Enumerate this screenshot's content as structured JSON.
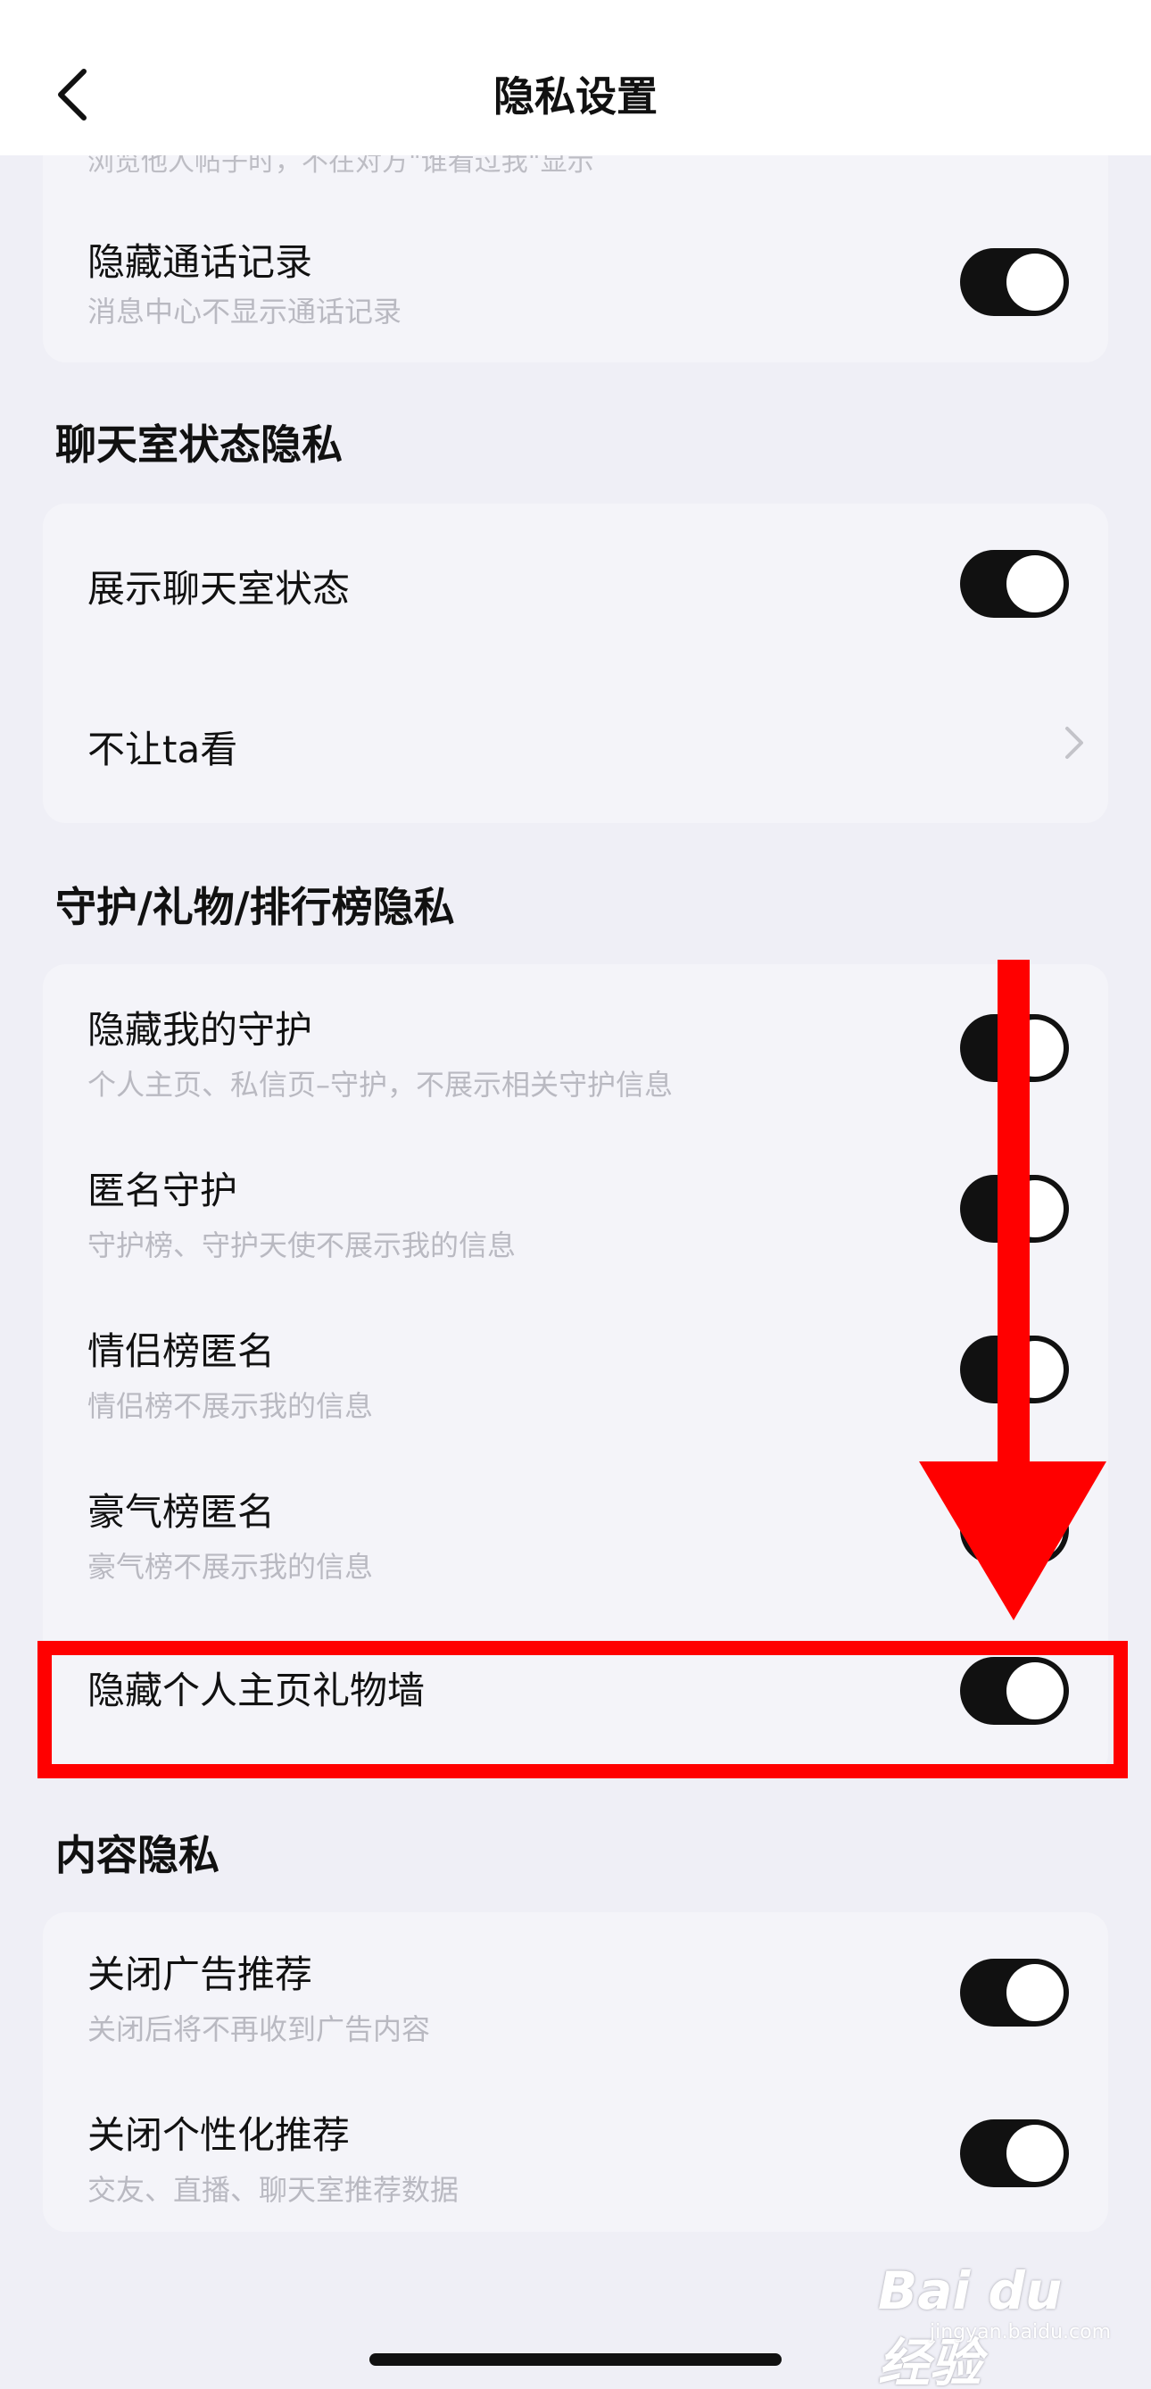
{
  "header": {
    "title": "隐私设置",
    "back_icon": "chevron-left-icon"
  },
  "top_partial": {
    "subtitle": "浏览他人帖子时，不在对方\"谁看过我\"显示"
  },
  "call_card": {
    "title": "隐藏通话记录",
    "subtitle": "消息中心不显示通话记录",
    "enabled": true
  },
  "chatroom": {
    "section_title": "聊天室状态隐私",
    "show_status": {
      "title": "展示聊天室状态",
      "enabled": true
    },
    "hide_from": {
      "title": "不让ta看",
      "icon": "chevron-right-icon"
    }
  },
  "guard": {
    "section_title": "守护/礼物/排行榜隐私",
    "items": [
      {
        "title": "隐藏我的守护",
        "subtitle": "个人主页、私信页–守护，不展示相关守护信息",
        "enabled": true
      },
      {
        "title": "匿名守护",
        "subtitle": "守护榜、守护天使不展示我的信息",
        "enabled": true
      },
      {
        "title": "情侣榜匿名",
        "subtitle": "情侣榜不展示我的信息",
        "enabled": true
      },
      {
        "title": "豪气榜匿名",
        "subtitle": "豪气榜不展示我的信息",
        "enabled": true
      },
      {
        "title": "隐藏个人主页礼物墙",
        "subtitle": "",
        "enabled": true
      }
    ]
  },
  "content": {
    "section_title": "内容隐私",
    "items": [
      {
        "title": "关闭广告推荐",
        "subtitle": "关闭后将不再收到广告内容",
        "enabled": true
      },
      {
        "title": "关闭个性化推荐",
        "subtitle": "交友、直播、聊天室推荐数据",
        "enabled": true
      }
    ]
  },
  "annotation": {
    "arrow_color": "#ff0000",
    "box_color": "#ff0000"
  },
  "watermark": {
    "logo": "Bai du 经验",
    "url": "jingyan.baidu.com"
  }
}
